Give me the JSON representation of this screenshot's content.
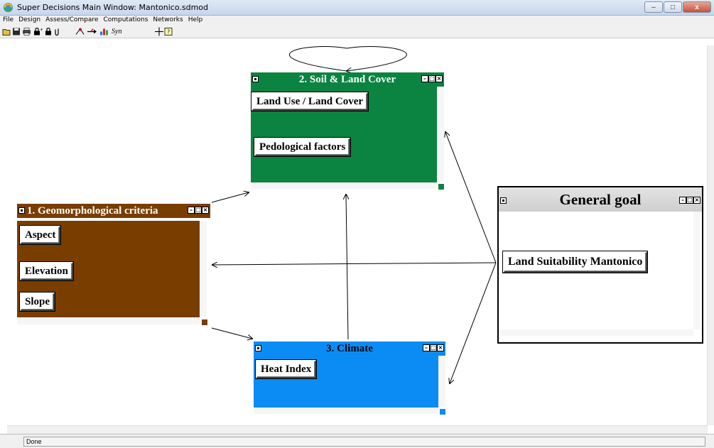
{
  "window": {
    "title": "Super Decisions Main Window: Mantonico.sdmod",
    "min_label": "–",
    "max_label": "□",
    "close_label": "x"
  },
  "menu": [
    "File",
    "Design",
    "Assess/Compare",
    "Computations",
    "Networks",
    "Help"
  ],
  "toolbar": {
    "syn_label": "Syn"
  },
  "clusters": {
    "soil": {
      "title": "2. Soil & Land Cover",
      "color": "#0b8441",
      "nodes": [
        "Land Use / Land Cover",
        "Pedological factors"
      ]
    },
    "geo": {
      "title": "1. Geomorphological criteria",
      "color": "#7a3d00",
      "nodes": [
        "Aspect",
        "Elevation",
        "Slope"
      ]
    },
    "climate": {
      "title": "3. Climate",
      "color": "#0b8cf5",
      "nodes": [
        "Heat Index"
      ]
    },
    "goal": {
      "title": "General goal",
      "color": "#ffffff",
      "nodes": [
        "Land Suitability Mantonico"
      ]
    }
  },
  "status": {
    "text": "Done"
  }
}
